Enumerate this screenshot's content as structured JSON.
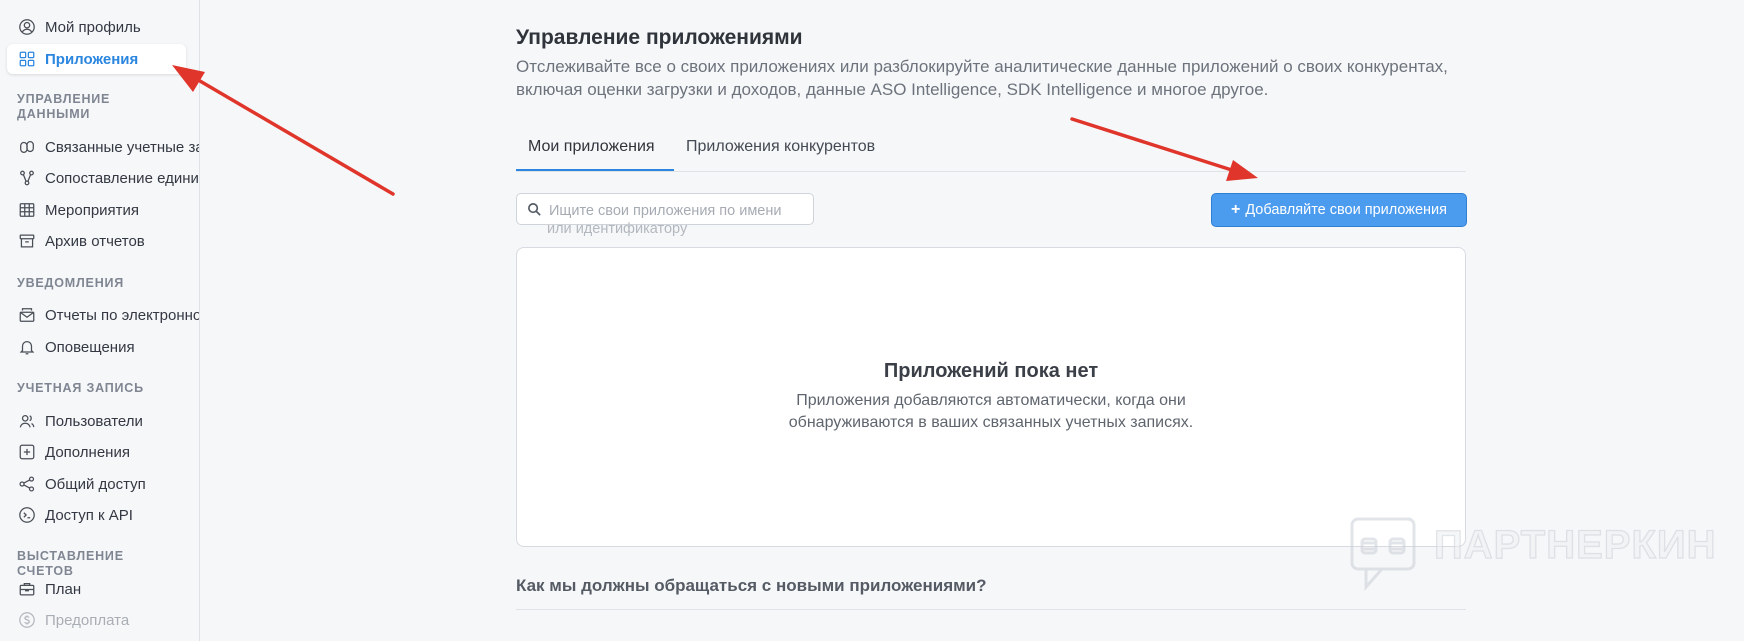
{
  "sidebar": {
    "items": [
      {
        "label": "Мой профиль",
        "icon": "user-circle-icon"
      },
      {
        "label": "Приложения",
        "icon": "apps-grid-icon",
        "active": true
      },
      {
        "label": "Связанные учетные записи",
        "icon": "link-icon"
      },
      {
        "label": "Сопоставление единиц",
        "icon": "mapping-icon"
      },
      {
        "label": "Мероприятия",
        "icon": "table-icon"
      },
      {
        "label": "Архив отчетов",
        "icon": "archive-icon"
      },
      {
        "label": "Отчеты по электронной почте",
        "icon": "mail-report-icon"
      },
      {
        "label": "Оповещения",
        "icon": "bell-icon"
      },
      {
        "label": "Пользователи",
        "icon": "users-icon"
      },
      {
        "label": "Дополнения",
        "icon": "plus-square-icon"
      },
      {
        "label": "Общий доступ",
        "icon": "share-icon"
      },
      {
        "label": "Доступ к API",
        "icon": "api-icon"
      },
      {
        "label": "План",
        "icon": "briefcase-icon"
      },
      {
        "label": "Предоплата",
        "icon": "dollar-circle-icon",
        "disabled": true
      }
    ],
    "sections": {
      "data_management": "УПРАВЛЕНИЕ ДАННЫМИ",
      "notifications": "УВЕДОМЛЕНИЯ",
      "account": "УЧЕТНАЯ ЗАПИСЬ",
      "billing": "ВЫСТАВЛЕНИЕ СЧЕТОВ"
    }
  },
  "main": {
    "title": "Управление приложениями",
    "description": "Отслеживайте все о своих приложениях или разблокируйте аналитические данные приложений о своих конкурентах, включая оценки загрузки и доходов, данные ASO Intelligence, SDK Intelligence и многое другое.",
    "tabs": [
      {
        "label": "Мои приложения",
        "active": true
      },
      {
        "label": "Приложения конкурентов",
        "active": false
      }
    ],
    "search": {
      "placeholder": "Ищите свои приложения по имени",
      "placeholder_overflow": "или идентификатору",
      "value": ""
    },
    "add_button": {
      "label": "Добавляйте свои приложения",
      "icon": "plus-icon"
    },
    "empty_state": {
      "title": "Приложений пока нет",
      "text_line1": "Приложения добавляются автоматически, когда они",
      "text_line2": "обнаруживаются в ваших связанных учетных записях."
    },
    "faq_question": "Как мы должны обращаться с новыми приложениями?"
  },
  "watermark": {
    "text": "ПАРТНЕРКИН"
  },
  "colors": {
    "accent": "#2b86e0",
    "button": "#4b9bef",
    "annotation_arrow": "#e0352b"
  }
}
